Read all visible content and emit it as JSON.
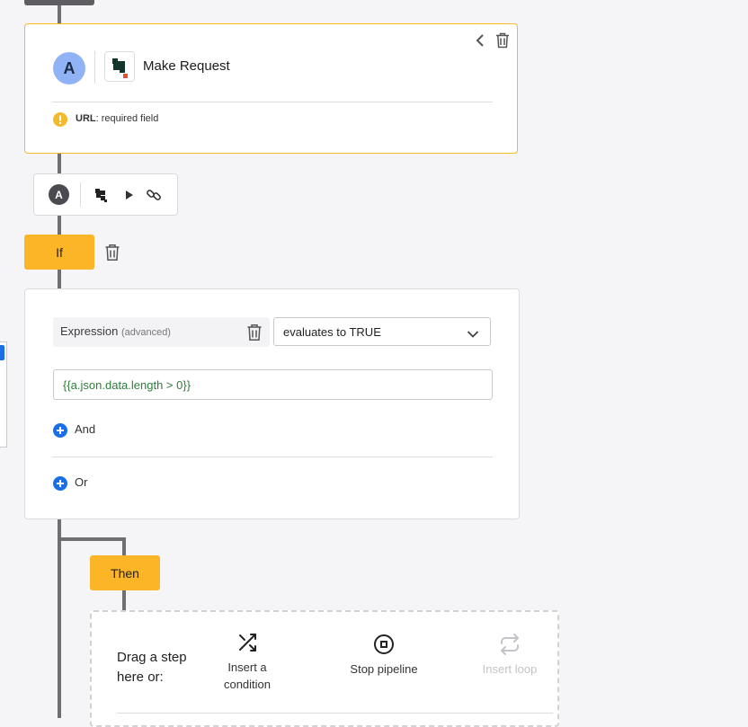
{
  "step": {
    "avatar_letter": "A",
    "title": "Make Request",
    "warning_field": "URL",
    "warning_text": ": required field"
  },
  "toolbar": {
    "avatar_letter": "A"
  },
  "if_block": {
    "label": "If"
  },
  "condition": {
    "expression_label": "Expression",
    "expression_hint": "(advanced)",
    "evaluates_option": "evaluates to TRUE",
    "expression_value": "{{a.json.data.length > 0}}",
    "and_label": "And",
    "or_label": "Or"
  },
  "then_block": {
    "label": "Then"
  },
  "drop_zone": {
    "prompt": "Drag a step here or:",
    "actions": [
      {
        "label": "Insert a condition",
        "icon": "shuffle-icon",
        "enabled": true
      },
      {
        "label": "Stop pipeline",
        "icon": "stop-circle-icon",
        "enabled": true
      },
      {
        "label": "Insert loop",
        "icon": "repeat-icon",
        "enabled": false
      }
    ]
  },
  "colors": {
    "accent_yellow": "#fbb526",
    "primary_blue": "#1a6ee8",
    "connector_gray": "#6e6e73",
    "warning_orange": "#f5b92e"
  }
}
